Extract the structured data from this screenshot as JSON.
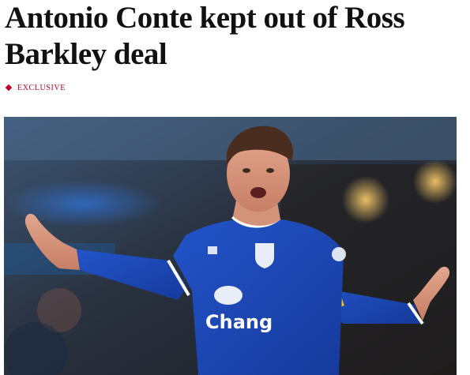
{
  "article": {
    "headline": "Antonio Conte kept out of Ross Barkley deal",
    "tag": {
      "icon": "diamond-icon",
      "label": "EXCLUSIVE",
      "color": "#c1001f"
    },
    "image": {
      "shirt_sponsor": "Chang",
      "colors": {
        "kit_blue": "#1b45b5",
        "kit_collar": "#ffffff"
      }
    }
  }
}
